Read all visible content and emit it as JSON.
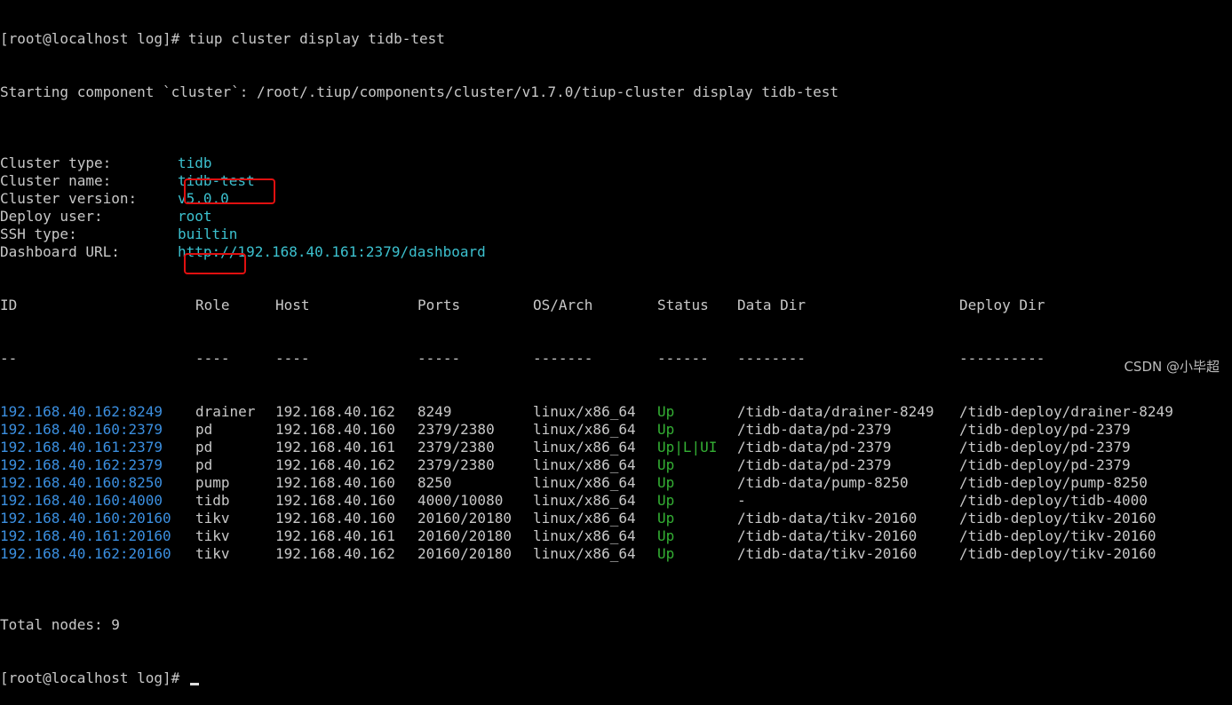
{
  "terminal": {
    "cmd_prompt": "[root@localhost log]# ",
    "cmd": "tiup cluster display tidb-test",
    "starting": "Starting component `cluster`: /root/.tiup/components/cluster/v1.7.0/tiup-cluster display tidb-test",
    "info": [
      {
        "label": "Cluster type:",
        "value": "tidb"
      },
      {
        "label": "Cluster name:",
        "value": "tidb-test"
      },
      {
        "label": "Cluster version:",
        "value": "v5.0.0"
      },
      {
        "label": "Deploy user:",
        "value": "root"
      },
      {
        "label": "SSH type:",
        "value": "builtin"
      },
      {
        "label": "Dashboard URL:",
        "value": "http://192.168.40.161:2379/dashboard"
      }
    ],
    "headers": [
      "ID",
      "Role",
      "Host",
      "Ports",
      "OS/Arch",
      "Status",
      "Data Dir",
      "Deploy Dir"
    ],
    "separators": [
      "--",
      "----",
      "----",
      "-----",
      "-------",
      "------",
      "--------",
      "----------"
    ],
    "rows": [
      [
        "192.168.40.162:8249",
        "drainer",
        "192.168.40.162",
        "8249",
        "linux/x86_64",
        "Up",
        "/tidb-data/drainer-8249",
        "/tidb-deploy/drainer-8249"
      ],
      [
        "192.168.40.160:2379",
        "pd",
        "192.168.40.160",
        "2379/2380",
        "linux/x86_64",
        "Up",
        "/tidb-data/pd-2379",
        "/tidb-deploy/pd-2379"
      ],
      [
        "192.168.40.161:2379",
        "pd",
        "192.168.40.161",
        "2379/2380",
        "linux/x86_64",
        "Up|L|UI",
        "/tidb-data/pd-2379",
        "/tidb-deploy/pd-2379"
      ],
      [
        "192.168.40.162:2379",
        "pd",
        "192.168.40.162",
        "2379/2380",
        "linux/x86_64",
        "Up",
        "/tidb-data/pd-2379",
        "/tidb-deploy/pd-2379"
      ],
      [
        "192.168.40.160:8250",
        "pump",
        "192.168.40.160",
        "8250",
        "linux/x86_64",
        "Up",
        "/tidb-data/pump-8250",
        "/tidb-deploy/pump-8250"
      ],
      [
        "192.168.40.160:4000",
        "tidb",
        "192.168.40.160",
        "4000/10080",
        "linux/x86_64",
        "Up",
        "-",
        "/tidb-deploy/tidb-4000"
      ],
      [
        "192.168.40.160:20160",
        "tikv",
        "192.168.40.160",
        "20160/20180",
        "linux/x86_64",
        "Up",
        "/tidb-data/tikv-20160",
        "/tidb-deploy/tikv-20160"
      ],
      [
        "192.168.40.161:20160",
        "tikv",
        "192.168.40.161",
        "20160/20180",
        "linux/x86_64",
        "Up",
        "/tidb-data/tikv-20160",
        "/tidb-deploy/tikv-20160"
      ],
      [
        "192.168.40.162:20160",
        "tikv",
        "192.168.40.162",
        "20160/20180",
        "linux/x86_64",
        "Up",
        "/tidb-data/tikv-20160",
        "/tidb-deploy/tikv-20160"
      ]
    ],
    "total": "Total nodes: 9",
    "final_prompt": "[root@localhost log]# "
  },
  "watermark": "CSDN @小毕超",
  "colors": {
    "background": "#000000",
    "text": "#c8c8c8",
    "value": "#3cc1cf",
    "id": "#3b8fe0",
    "status_up": "#34b034",
    "highlight_box": "#e01010"
  }
}
